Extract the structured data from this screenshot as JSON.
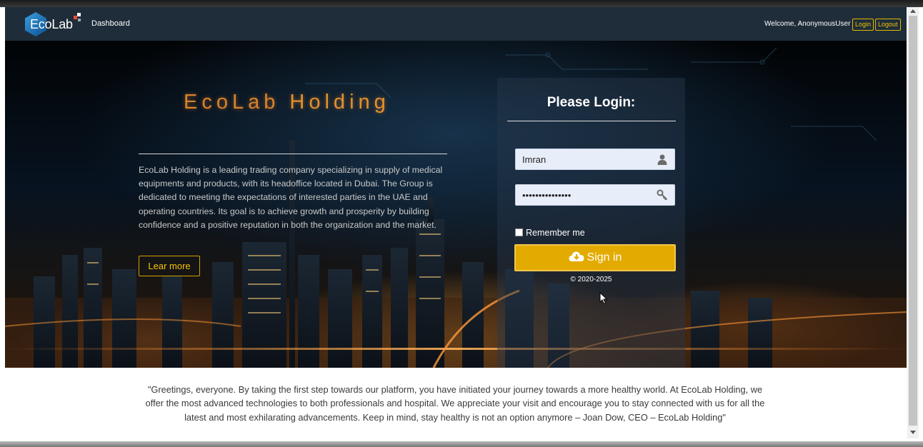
{
  "navbar": {
    "brand": "EcoLab",
    "dashboard_label": "Dashboard",
    "welcome_text": "Welcome, AnonymousUser",
    "login_label": "Login",
    "logout_label": "Logout"
  },
  "hero": {
    "title_part1": "EcoLab",
    "title_part2": "Holding",
    "description": "EcoLab Holding is a leading trading company specializing in supply of medical equipments and products, with its headoffice located in Dubai. The Group is dedicated to meeting the expectations of interested parties in the UAE and operating countries. Its goal is to achieve growth and prosperity by building confidence and a positive reputation in both the organization and the market.",
    "learn_more_label": "Lear more"
  },
  "login": {
    "title": "Please Login:",
    "username_value": "Imran",
    "password_value": "•••••••••••••••",
    "remember_label": "Remember me",
    "signin_label": "Sign in",
    "copyright": "© 2020-2025"
  },
  "quote": {
    "text": "\"Greetings, everyone. By taking the first step towards our platform, you have initiated your journey towards a more healthy world. At EcoLab Holding, we offer the most advanced technologies to both professionals and hospital. We appreciate your visit and encourage you to stay connected with us for all the latest and most exhilarating advancements. Keep in mind, stay healthy is not an option anymore – Joan Dow, CEO – EcoLab Holding\""
  },
  "colors": {
    "navbar_bg": "#1f2d3a",
    "accent": "#e3ab00",
    "title_orange": "#d9822b"
  },
  "icons": {
    "user_field": "user-icon",
    "password_field": "key-icon",
    "signin": "cloud-download-icon"
  }
}
